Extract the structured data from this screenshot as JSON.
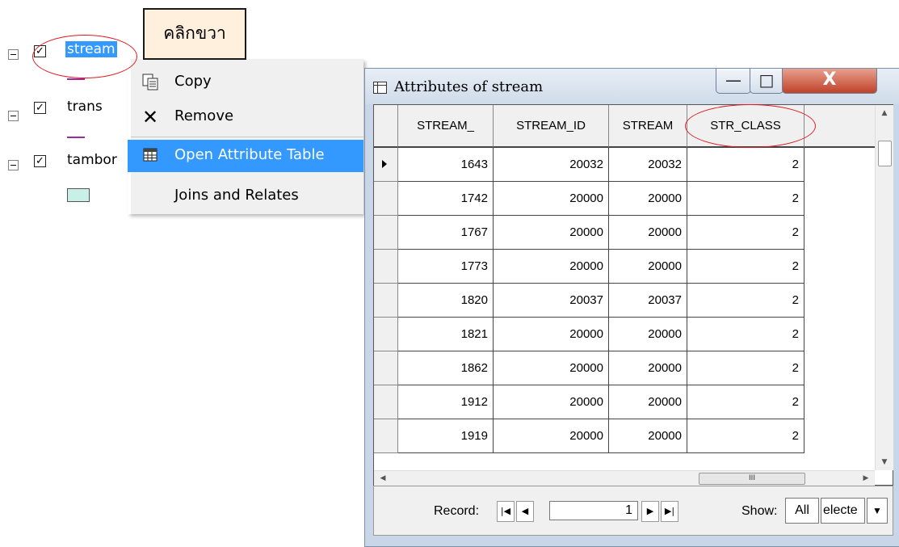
{
  "toc": {
    "layers": [
      {
        "name": "stream",
        "checked": true,
        "legend": "line",
        "legend_color": "#9b2c9b"
      },
      {
        "name": "trans",
        "checked": true,
        "legend": "line",
        "legend_color": "#9b2c9b"
      },
      {
        "name": "tambor",
        "checked": true,
        "legend": "polygon",
        "legend_color": "#c8f0e6"
      }
    ]
  },
  "callout": {
    "text": "คลิกขวา"
  },
  "context_menu": {
    "items": [
      {
        "label": "Copy",
        "icon": "copy-icon"
      },
      {
        "label": "Remove",
        "icon": "remove-x-icon"
      },
      {
        "label": "Open Attribute Table",
        "icon": "table-icon"
      },
      {
        "label": "Joins and Relates",
        "icon": ""
      }
    ]
  },
  "attributes_window": {
    "title": "Attributes of stream",
    "columns": [
      "STREAM_",
      "STREAM_ID",
      "STREAM",
      "STR_CLASS"
    ],
    "rows": [
      [
        "1643",
        "20032",
        "20032",
        "2"
      ],
      [
        "1742",
        "20000",
        "20000",
        "2"
      ],
      [
        "1767",
        "20000",
        "20000",
        "2"
      ],
      [
        "1773",
        "20000",
        "20000",
        "2"
      ],
      [
        "1820",
        "20037",
        "20037",
        "2"
      ],
      [
        "1821",
        "20000",
        "20000",
        "2"
      ],
      [
        "1862",
        "20000",
        "20000",
        "2"
      ],
      [
        "1912",
        "20000",
        "20000",
        "2"
      ],
      [
        "1919",
        "20000",
        "20000",
        "2"
      ]
    ],
    "hscroll_grip": "III",
    "nav": {
      "record_label": "Record:",
      "record_value": "1",
      "show_label": "Show:",
      "show_all": "All",
      "show_selected": "electe"
    }
  },
  "colors": {
    "selection": "#3399ff",
    "highlight_ellipse": "#e0191f",
    "callout_bg": "#fef0dc"
  }
}
